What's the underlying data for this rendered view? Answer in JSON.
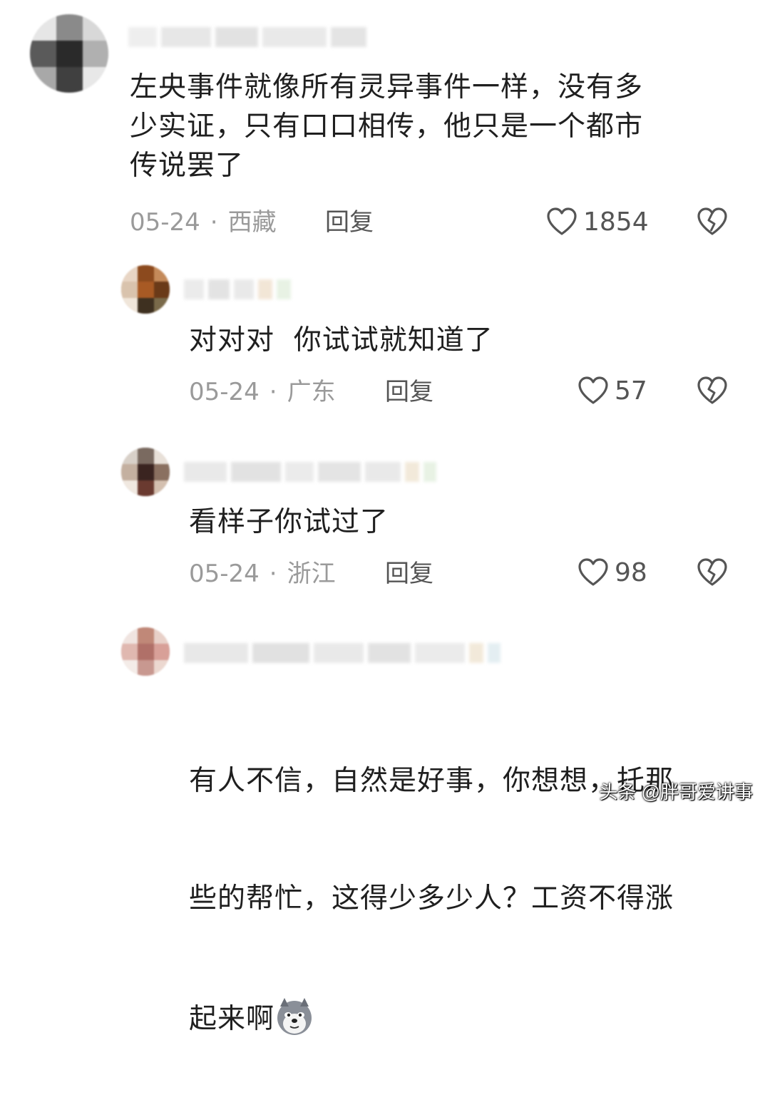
{
  "comments": [
    {
      "text": "左央事件就像所有灵异事件一样，没有多\n少实证，只有口口相传，他只是一个都市\n传说罢了",
      "date": "05-24",
      "location": "西藏",
      "reply_label": "回复",
      "likes": "1854"
    },
    {
      "text": "对对对  你试试就知道了",
      "date": "05-24",
      "location": "广东",
      "reply_label": "回复",
      "likes": "57"
    },
    {
      "text": "看样子你试过了",
      "date": "05-24",
      "location": "浙江",
      "reply_label": "回复",
      "likes": "98"
    },
    {
      "text_line1": "有人不信，自然是好事，你想想，托那",
      "text_line2": "些的帮忙，这得少多少人？工资不得涨",
      "text_line3": "起来啊",
      "emoji": "dog-emoji"
    }
  ],
  "separator": "·",
  "watermark": "头条 @胖哥爱讲事",
  "colors": {
    "text": "#1f1f1f",
    "meta": "#9a9a9a",
    "icon": "#555555"
  }
}
